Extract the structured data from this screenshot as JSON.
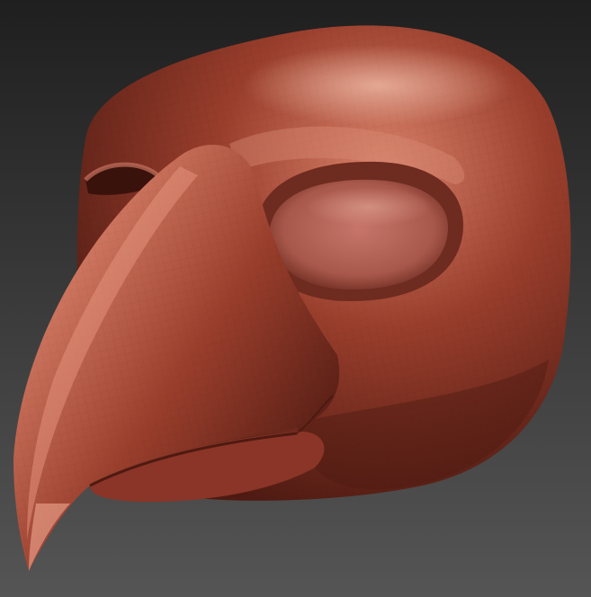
{
  "viewport": {
    "subject": "bird-mask-sculpt",
    "background_top": "#1f1f1f",
    "background_bottom": "#555555"
  },
  "model": {
    "material_base": "#9a3e2c",
    "material_highlight": "#d9826b",
    "material_shadow": "#4e1a12",
    "specular": "#f2c0ac"
  }
}
